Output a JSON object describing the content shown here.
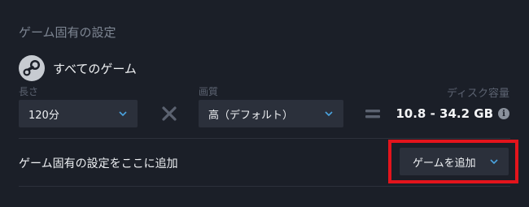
{
  "section_title": "ゲーム固有の設定",
  "all_games": {
    "label": "すべてのゲーム",
    "icon": "steam-logo-icon"
  },
  "length": {
    "label": "長さ",
    "value": "120分"
  },
  "quality": {
    "label": "画質",
    "value": "高（デフォルト）"
  },
  "disk": {
    "label": "ディスク容量",
    "value": "10.8 - 34.2 GB"
  },
  "add_setting": {
    "label": "ゲーム固有の設定をここに追加",
    "button_label": "ゲームを追加"
  },
  "colors": {
    "background": "#1b1f28",
    "control": "#2b303b",
    "accent_chevron": "#4aa3df",
    "highlight": "#e3141c"
  }
}
